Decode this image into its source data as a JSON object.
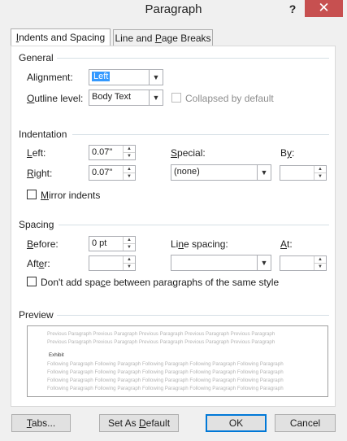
{
  "window": {
    "title": "Paragraph",
    "help_glyph": "?",
    "close_glyph": "✕"
  },
  "tabs": [
    {
      "label_pre": "",
      "label_u": "I",
      "label_post": "ndents and Spacing",
      "active": true
    },
    {
      "label_pre": "Line and ",
      "label_u": "P",
      "label_post": "age Breaks",
      "active": false
    }
  ],
  "general": {
    "heading": "General",
    "alignment_pre": "Ali",
    "alignment_u": "g",
    "alignment_post": "nment:",
    "alignment_value": "Left",
    "outline_u": "O",
    "outline_post": "utline level:",
    "outline_value": "Body Text",
    "collapsed_label": "Collapsed by default"
  },
  "indentation": {
    "heading": "Indentation",
    "left_u": "L",
    "left_post": "eft:",
    "left_value": "0.07\"",
    "right_u": "R",
    "right_post": "ight:",
    "right_value": "0.07\"",
    "special_u": "S",
    "special_post": "pecial:",
    "special_value": "(none)",
    "by_pre": "B",
    "by_u": "y",
    "by_post": ":",
    "by_value": "",
    "mirror_u": "M",
    "mirror_post": "irror indents"
  },
  "spacing": {
    "heading": "Spacing",
    "before_u": "B",
    "before_post": "efore:",
    "before_value": "0 pt",
    "after_pre": "Aft",
    "after_u": "e",
    "after_post": "r:",
    "after_value": "",
    "line_pre": "Li",
    "line_u": "n",
    "line_post": "e spacing:",
    "line_value": "",
    "at_u": "A",
    "at_post": "t:",
    "at_value": "",
    "dont_add_pre": "Don't add spa",
    "dont_add_u": "c",
    "dont_add_post": "e between paragraphs of the same style"
  },
  "preview": {
    "heading": "Preview",
    "previous_lines": [
      "Previous Paragraph Previous Paragraph Previous Paragraph Previous Paragraph Previous Paragraph",
      "Previous Paragraph Previous Paragraph Previous Paragraph Previous Paragraph Previous Paragraph"
    ],
    "sample_text": "Exhibit",
    "following_lines": [
      "Following Paragraph Following Paragraph Following Paragraph Following Paragraph Following Paragraph",
      "Following Paragraph Following Paragraph Following Paragraph Following Paragraph Following Paragraph",
      "Following Paragraph Following Paragraph Following Paragraph Following Paragraph Following Paragraph",
      "Following Paragraph Following Paragraph Following Paragraph Following Paragraph Following Paragraph",
      "Following Paragraph Following Paragraph Following Paragraph Following Paragraph Following Paragraph"
    ]
  },
  "buttons": {
    "tabs_u": "T",
    "tabs_post": "abs...",
    "default_pre": "Set As ",
    "default_u": "D",
    "default_post": "efault",
    "ok": "OK",
    "cancel": "Cancel"
  },
  "colors": {
    "accent": "#0078d7",
    "close_red": "#c75050",
    "selection": "#3399ff"
  }
}
